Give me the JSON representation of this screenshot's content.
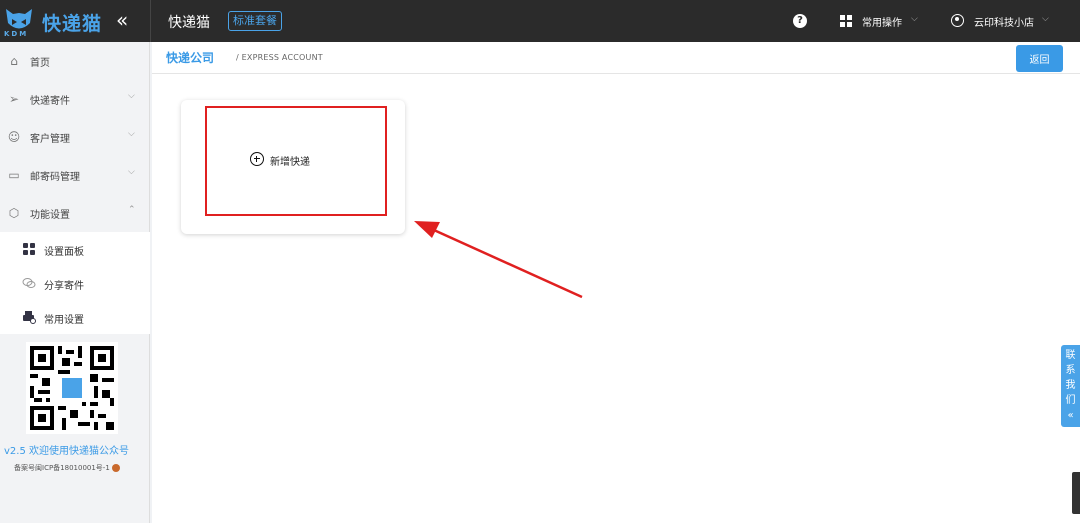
{
  "topbar": {
    "logo_text": "KDM",
    "brand_name": "快递猫",
    "collapse_icon": "«",
    "title": "快递猫",
    "plan_badge": "标准套餐",
    "help_icon": "?",
    "common_ops": "常用操作",
    "user_name": "云印科技小店"
  },
  "sidebar": {
    "items": [
      {
        "label": "首页",
        "icon": "home-icon"
      },
      {
        "label": "快递寄件",
        "icon": "send-icon"
      },
      {
        "label": "客户管理",
        "icon": "user-icon"
      },
      {
        "label": "邮寄码管理",
        "icon": "code-icon"
      },
      {
        "label": "功能设置",
        "icon": "settings-icon"
      }
    ],
    "sub_items": [
      {
        "label": "设置面板",
        "icon": "grid-icon"
      },
      {
        "label": "分享寄件",
        "icon": "share-icon"
      },
      {
        "label": "常用设置",
        "icon": "printer-icon"
      }
    ],
    "version": "v2.5 欢迎使用快递猫公众号",
    "icp": "备案号闽ICP备18010001号-1"
  },
  "breadcrumb": {
    "title": "快递公司",
    "subtitle": "/ EXPRESS ACCOUNT"
  },
  "back_label": "返回",
  "card": {
    "add_label": "新增快递"
  },
  "contact": {
    "chars": [
      "联",
      "系",
      "我",
      "们",
      "«"
    ]
  },
  "colors": {
    "accent": "#3a9ae6",
    "topbar": "#2b2b2b",
    "highlight": "#e02020"
  }
}
